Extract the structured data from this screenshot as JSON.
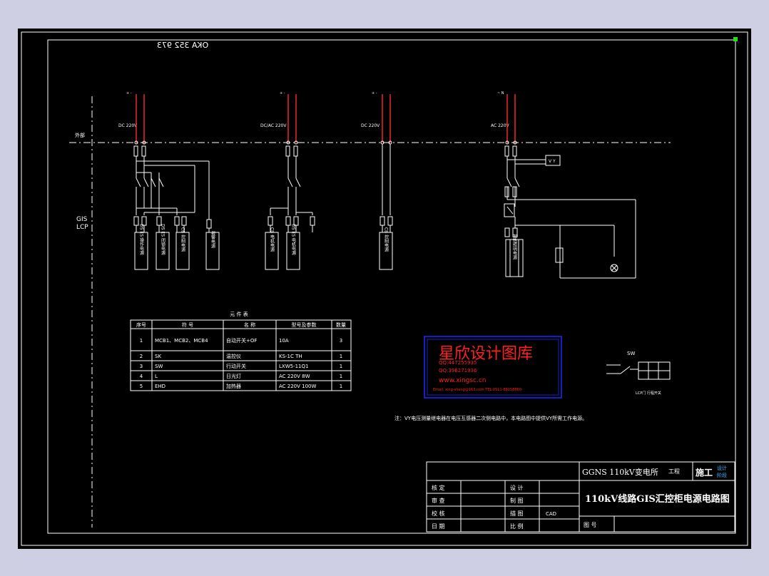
{
  "drawing_code": "OKA 352 973",
  "labels": {
    "outside": "外部",
    "gis_lcp_line1": "GIS",
    "gis_lcp_line2": "LCP"
  },
  "circuits": [
    {
      "voltage": "DC 220V",
      "top": "+ -"
    },
    {
      "voltage": "DC/AC 220V",
      "top": "+ -"
    },
    {
      "voltage": "DC 220V",
      "top": "+ -"
    },
    {
      "voltage": "AC 220V",
      "top": "~ N"
    }
  ],
  "boxes": {
    "c1": [
      "DS ES 操作电源",
      "DS ES 闭锁电源",
      "CB 控制电源",
      "报警电源"
    ],
    "c2": [
      "CB 电机电源",
      "DS ES 电机电源"
    ],
    "c3": [
      "CB 控制电源"
    ],
    "c4": [
      "加热照明电源"
    ]
  },
  "table": {
    "title": "元 件 表",
    "headers": [
      "序号",
      "符 号",
      "名 称",
      "型号及参数",
      "数量"
    ],
    "rows": [
      [
        "1",
        "MCB1、MCB2、MCB4",
        "自动开关+OF",
        "10A",
        "3"
      ],
      [
        "2",
        "SK",
        "温控仪",
        "KS-1C TH",
        "1"
      ],
      [
        "3",
        "SW",
        "行动开关",
        "LXW5-11Q1",
        "1"
      ],
      [
        "4",
        "L",
        "日光灯",
        "AC 220V 8W",
        "1"
      ],
      [
        "5",
        "EHD",
        "加热器",
        "AC 220V 100W",
        "1"
      ]
    ]
  },
  "watermark": {
    "title": "星欣设计图库",
    "qq1": "QQ:447255935",
    "qq2": "QQ:396271936",
    "site": "www.xingsc.cn",
    "email": "Email: xing-sheng@163.com  TEL:0511-88158860"
  },
  "sw_label": "SW",
  "sw_caption": "LCP门 行程开关",
  "note": "注：VY电压测量继电器在电压互感器二次侧电路中，本电路图中提供VY所需工作电源。",
  "title_block": {
    "project": "GGNS 110kV变电所",
    "project_suffix": "工程",
    "stage": "施工",
    "stage_sub_1": "设计",
    "stage_sub_2": "阶段",
    "drawing_title": "110kV线路GIS汇控柜电源电路图",
    "left_labels": [
      "核 定",
      "审 查",
      "校 核",
      "日 期"
    ],
    "mid_labels": [
      "设 计",
      "制 图",
      "描 图",
      "比 例"
    ],
    "mid_values": [
      "",
      "",
      "CAD",
      ""
    ],
    "figure_no_label": "图 号"
  },
  "colors": {
    "background": "#000000",
    "line": "#ffffff",
    "live_wire": "#ff2a2a",
    "watermark": "#ff2020",
    "watermark_border": "#1a2cff",
    "green_marker": "#22dd22",
    "stage_accent": "#38b7ff"
  }
}
